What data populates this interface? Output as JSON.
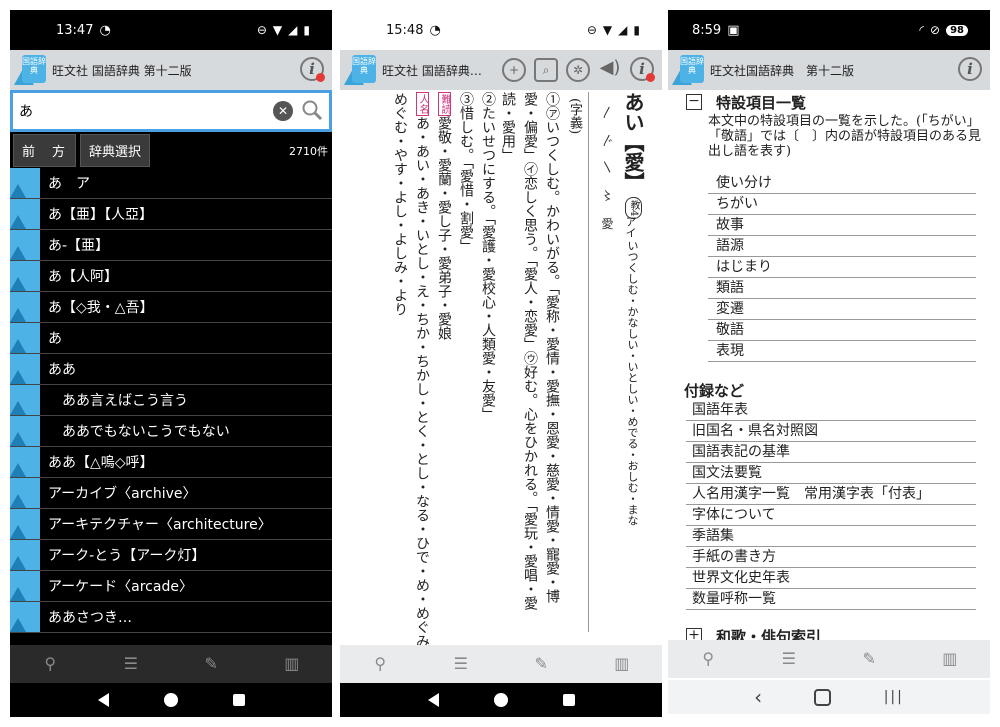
{
  "phone1": {
    "status": {
      "time": "13:47"
    },
    "header": {
      "title": "旺文社 国語辞典 第十二版"
    },
    "search": {
      "value": "あ"
    },
    "controls": {
      "prefix_label": "前　方",
      "dict_label": "辞典選択",
      "count": "2710件"
    },
    "results": [
      {
        "text": "あ　ア",
        "indent": false
      },
      {
        "text": "あ【亜】【⼈亞】",
        "indent": false
      },
      {
        "text": "あ-【亜】",
        "indent": false
      },
      {
        "text": "あ【⼈阿】",
        "indent": false
      },
      {
        "text": "あ【◇我・△吾】",
        "indent": false
      },
      {
        "text": "あ",
        "indent": false
      },
      {
        "text": "ああ",
        "indent": false
      },
      {
        "text": "ああ言えばこう言う",
        "indent": true
      },
      {
        "text": "ああでもないこうでもない",
        "indent": true
      },
      {
        "text": "ああ【△嗚◇呼】",
        "indent": false
      },
      {
        "text": "アーカイブ〈archive〉",
        "indent": false
      },
      {
        "text": "アーキテクチャー〈architecture〉",
        "indent": false
      },
      {
        "text": "アーク-とう【アーク灯】",
        "indent": false
      },
      {
        "text": "アーケード〈arcade〉",
        "indent": false
      },
      {
        "text": "ああさつき…",
        "indent": false
      }
    ]
  },
  "phone2": {
    "status": {
      "time": "15:48"
    },
    "header": {
      "title": "旺文社 国語辞典…"
    },
    "entry": {
      "headword": "あい【愛】",
      "reading_on": "アイ",
      "grade_badge": "教4",
      "kun_readings": "いつくしむ・かなしい・いとしい・めでる・おしむ・まな",
      "stroke_order": "〳 〴 〵 〻 愛",
      "section_label": "(字義)",
      "meaning1": "①㋐いつくしむ。かわいがる。「愛称・愛情・愛撫・恩愛・慈愛・情愛・寵愛・博",
      "meaning1b": "愛・偏愛」㋑恋しく思う。「愛人・恋愛」㋒好む。心をひかれる。「愛玩・愛唱・愛",
      "meaning1c": "読・愛用」",
      "meaning2": "②たいせつにする。「愛護・愛校心・人類愛・友愛」",
      "meaning3": "③惜しむ。「愛惜・割愛」",
      "special_tag": "難読",
      "special_words": "愛敬・愛蘭・愛し子・愛弟子・愛娘",
      "name_tag": "人名",
      "name_readings": "あ・あい・あき・いとし・え・ちか・ちかし・とく・とし・なる・ひで・め・めぐみ・",
      "name_readings2": "めぐむ・やす・よし・よしみ・より"
    }
  },
  "phone3": {
    "status": {
      "time": "8:59",
      "battery": "98"
    },
    "header": {
      "title": "旺文社国語辞典　第十二版"
    },
    "section1": {
      "title": "特設項目一覧",
      "toggle": "−",
      "description": "本文中の特設項目の一覧を示した。(「ちがい」「敬語」では〔　〕内の語が特設項目のある見出し語を表す)",
      "items": [
        "使い分け",
        "ちがい",
        "故事",
        "語源",
        "はじまり",
        "類語",
        "変遷",
        "敬語",
        "表現"
      ]
    },
    "section2": {
      "title": "付録など",
      "items": [
        "国語年表",
        "旧国名・県名対照図",
        "国語表記の基準",
        "国文法要覧",
        "人名用漢字一覧　常用漢字表「付表」",
        "字体について",
        "季語集",
        "手紙の書き方",
        "世界文化史年表",
        "数量呼称一覧"
      ]
    },
    "section3": {
      "title": "和歌・俳句索引",
      "toggle": "+"
    }
  },
  "logo": {
    "text": "国語辞典"
  },
  "colors": {
    "accent": "#4ba0e3",
    "logo": "#4db2e6",
    "tag": "#d2357c",
    "header": "#d7dadd"
  }
}
